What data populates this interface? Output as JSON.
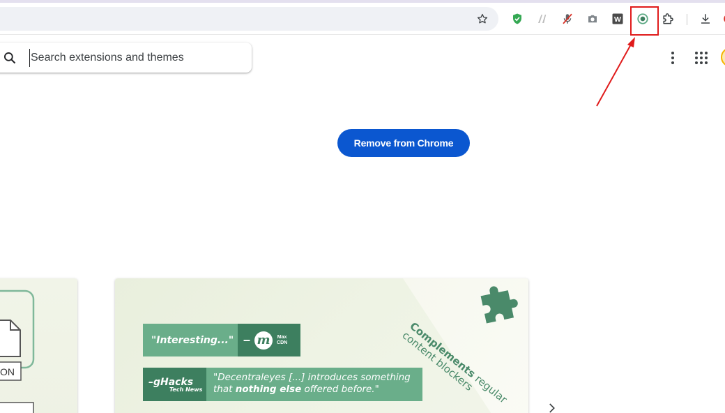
{
  "toolbar": {
    "bookmark_icon": "star-outline-icon",
    "extension_icons": [
      "shield-check-icon",
      "fork-icon",
      "mic-off-icon",
      "camera-icon",
      "w-square-icon",
      "decentraleyes-icon",
      "puzzle-piece-icon",
      "download-icon"
    ],
    "w_letter": "W",
    "highlight_color": "#e01b1b"
  },
  "search": {
    "placeholder": "Search extensions and themes",
    "value": ""
  },
  "header_actions": {
    "more_icon": "more-vert-icon",
    "apps_icon": "apps-grid-icon"
  },
  "primary_action": {
    "label": "Remove from Chrome",
    "color": "#0b57d0"
  },
  "gallery": {
    "left_card_text": "ON",
    "quote1": {
      "text": "\"Interesting...\"",
      "brand_letter": "m",
      "brand_line1": "Max",
      "brand_line2": "CDN"
    },
    "quote2": {
      "brand": "gHacks",
      "brand_sub": "Tech News",
      "text_part1": "\"Decentraleyes [...] introduces something that ",
      "text_bold": "nothing else",
      "text_part2": " offered before.\""
    },
    "diagonal_bold": "Complements",
    "diagonal_rest1": " regular",
    "diagonal_line2": "content blockers",
    "next_icon": "chevron-right-icon",
    "accent_color": "#3d7f5f",
    "light_color": "#6aae8a"
  }
}
